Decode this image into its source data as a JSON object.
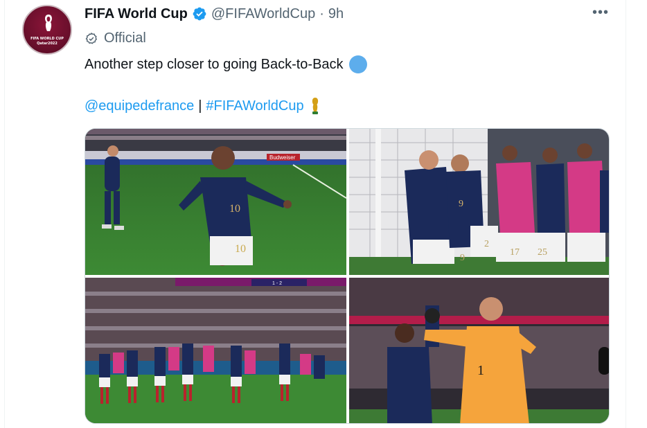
{
  "tweet": {
    "author_name": "FIFA World Cup",
    "handle": "@FIFAWorldCup",
    "time_sep": "·",
    "time": "9h",
    "label": "Official",
    "text": "Another step closer to going Back-to-Back",
    "mention": "@equipedefrance",
    "separator": "|",
    "hashtag": "#FIFAWorldCup",
    "more_menu": "•••"
  },
  "avatar": {
    "line1": "FIFA WORLD CUP",
    "line2": "Qatar2022"
  },
  "photos": {
    "photo1": {
      "jersey_number": "10",
      "board": "Budweiser"
    },
    "photo2": {
      "numbers": [
        "9",
        "2",
        "17",
        "25"
      ]
    },
    "photo3": {
      "score": "1 - 2"
    },
    "photo4": {
      "jersey_number": "1"
    }
  },
  "colors": {
    "link": "#1d9bf0",
    "secondary": "#536471",
    "verified": "#1d9bf0",
    "france_navy": "#1b2a5a",
    "keeper_orange": "#f5a43c"
  }
}
